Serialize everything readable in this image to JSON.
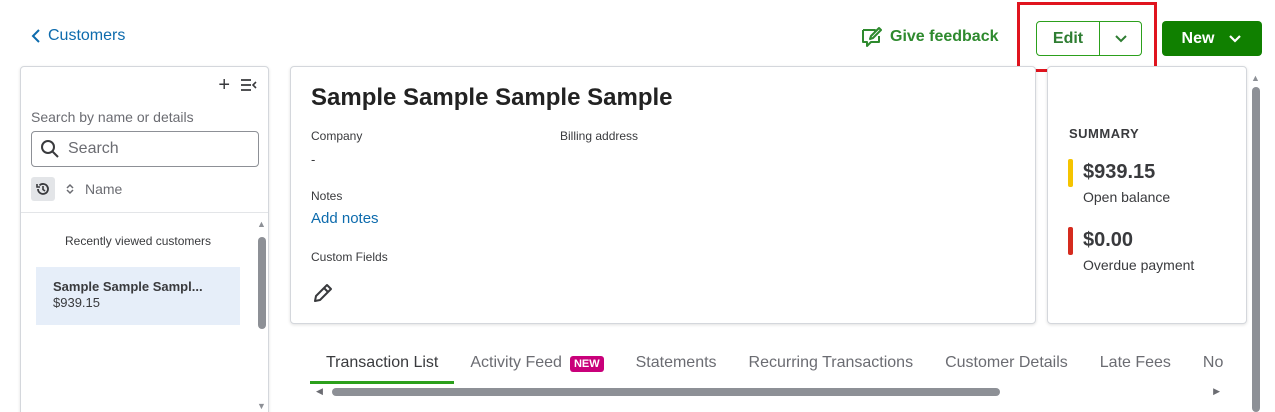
{
  "header": {
    "back_label": "Customers",
    "feedback_label": "Give feedback",
    "edit_label": "Edit",
    "new_label": "New"
  },
  "sidebar": {
    "search_hint": "Search by name or details",
    "search_placeholder": "Search",
    "sort_label": "Name",
    "recent_title": "Recently viewed customers",
    "recent_items": [
      {
        "name": "Sample Sample Sampl...",
        "amount": "$939.15"
      }
    ]
  },
  "customer": {
    "name": "Sample Sample Sample Sample",
    "company_label": "Company",
    "company_value": "-",
    "billing_label": "Billing address",
    "notes_label": "Notes",
    "add_notes_label": "Add notes",
    "custom_fields_label": "Custom Fields"
  },
  "summary": {
    "title": "SUMMARY",
    "open_balance_amount": "$939.15",
    "open_balance_label": "Open balance",
    "overdue_amount": "$0.00",
    "overdue_label": "Overdue payment",
    "open_color": "#f5c400",
    "overdue_color": "#d52b1e"
  },
  "tabs": [
    {
      "label": "Transaction List",
      "active": true
    },
    {
      "label": "Activity Feed",
      "badge": "NEW"
    },
    {
      "label": "Statements"
    },
    {
      "label": "Recurring Transactions"
    },
    {
      "label": "Customer Details"
    },
    {
      "label": "Late Fees"
    },
    {
      "label": "No"
    }
  ],
  "colors": {
    "accent_green": "#2ca01c",
    "primary_button": "#108000",
    "link_blue": "#0d6bad",
    "highlight_red": "#e0141e"
  }
}
